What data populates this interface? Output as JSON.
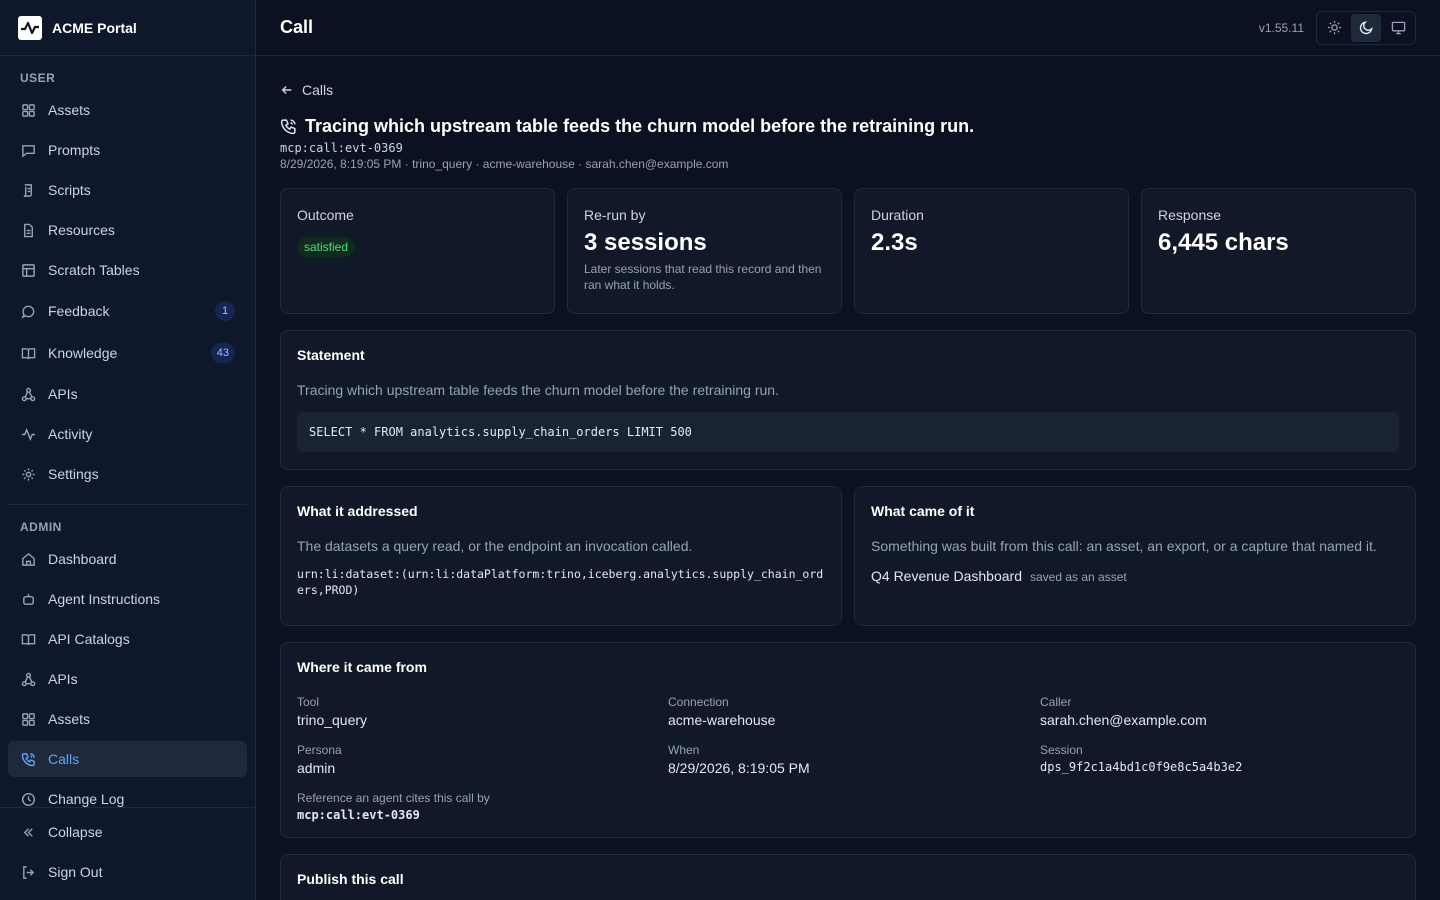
{
  "app": {
    "name": "ACME Portal",
    "version": "v1.55.11"
  },
  "header": {
    "title": "Call"
  },
  "sidebar": {
    "user_label": "USER",
    "user_items": [
      {
        "label": "Assets",
        "icon": "grid-icon"
      },
      {
        "label": "Prompts",
        "icon": "message-icon"
      },
      {
        "label": "Scripts",
        "icon": "script-icon"
      },
      {
        "label": "Resources",
        "icon": "file-icon"
      },
      {
        "label": "Scratch Tables",
        "icon": "table-icon"
      },
      {
        "label": "Feedback",
        "icon": "chat-icon",
        "badge": "1"
      },
      {
        "label": "Knowledge",
        "icon": "book-icon",
        "badge": "43"
      },
      {
        "label": "APIs",
        "icon": "network-icon"
      },
      {
        "label": "Activity",
        "icon": "activity-icon"
      },
      {
        "label": "Settings",
        "icon": "gear-icon"
      }
    ],
    "admin_label": "ADMIN",
    "admin_items": [
      {
        "label": "Dashboard",
        "icon": "home-icon"
      },
      {
        "label": "Agent Instructions",
        "icon": "agent-icon"
      },
      {
        "label": "API Catalogs",
        "icon": "book-icon"
      },
      {
        "label": "APIs",
        "icon": "network-icon"
      },
      {
        "label": "Assets",
        "icon": "grid-icon"
      },
      {
        "label": "Calls",
        "icon": "phone-icon",
        "active": true
      },
      {
        "label": "Change Log",
        "icon": "clock-icon"
      }
    ],
    "collapse_label": "Collapse",
    "signout_label": "Sign Out"
  },
  "page": {
    "back_label": "Calls",
    "title": "Tracing which upstream table feeds the churn model before the retraining run.",
    "ref_id": "mcp:call:evt-0369",
    "meta": "8/29/2026, 8:19:05 PM · trino_query · acme-warehouse · sarah.chen@example.com"
  },
  "stats": {
    "outcome": {
      "label": "Outcome",
      "value": "satisfied"
    },
    "rerun": {
      "label": "Re-run by",
      "value": "3 sessions",
      "note": "Later sessions that read this record and then ran what it holds."
    },
    "duration": {
      "label": "Duration",
      "value": "2.3s"
    },
    "response": {
      "label": "Response",
      "value": "6,445 chars"
    }
  },
  "statement": {
    "heading": "Statement",
    "text": "Tracing which upstream table feeds the churn model before the retraining run.",
    "sql": "SELECT * FROM analytics.supply_chain_orders LIMIT 500"
  },
  "addressed": {
    "heading": "What it addressed",
    "text": "The datasets a query read, or the endpoint an invocation called.",
    "urn": "urn:li:dataset:(urn:li:dataPlatform:trino,iceberg.analytics.supply_chain_orders,PROD)"
  },
  "outcome_card": {
    "heading": "What came of it",
    "text": "Something was built from this call: an asset, an export, or a capture that named it.",
    "asset_name": "Q4 Revenue Dashboard",
    "asset_note": "saved as an asset"
  },
  "origin": {
    "heading": "Where it came from",
    "tool_label": "Tool",
    "tool": "trino_query",
    "connection_label": "Connection",
    "connection": "acme-warehouse",
    "caller_label": "Caller",
    "caller": "sarah.chen@example.com",
    "persona_label": "Persona",
    "persona": "admin",
    "when_label": "When",
    "when": "8/29/2026, 8:19:05 PM",
    "session_label": "Session",
    "session": "dps_9f2c1a4bd1c0f9e8c5a4b3e2",
    "reference_label": "Reference an agent cites this call by",
    "reference": "mcp:call:evt-0369"
  },
  "publish": {
    "heading": "Publish this call"
  }
}
